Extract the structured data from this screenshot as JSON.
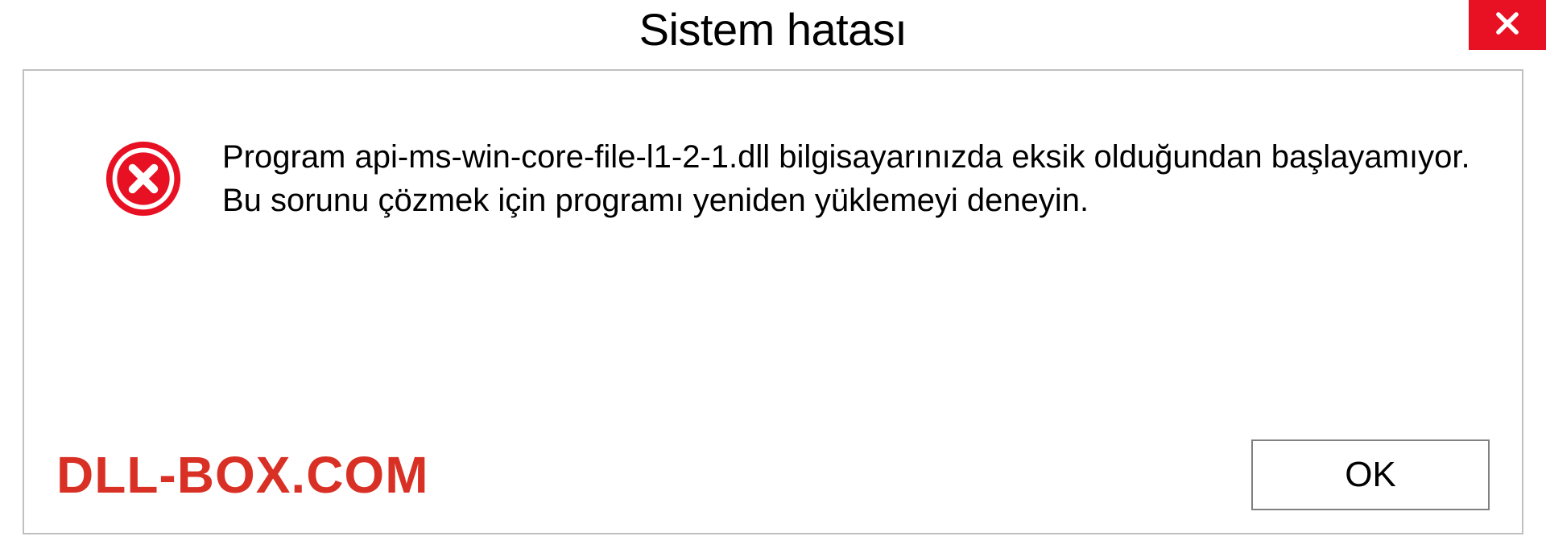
{
  "dialog": {
    "title": "Sistem hatası",
    "message": "Program api-ms-win-core-file-l1-2-1.dll bilgisayarınızda eksik olduğundan başlayamıyor. Bu sorunu çözmek için programı yeniden yüklemeyi deneyin.",
    "ok_label": "OK"
  },
  "watermark": "DLL-BOX.COM",
  "colors": {
    "close_bg": "#e81123",
    "error_icon": "#e81123",
    "watermark": "#d93025",
    "border": "#c0c0c0"
  }
}
